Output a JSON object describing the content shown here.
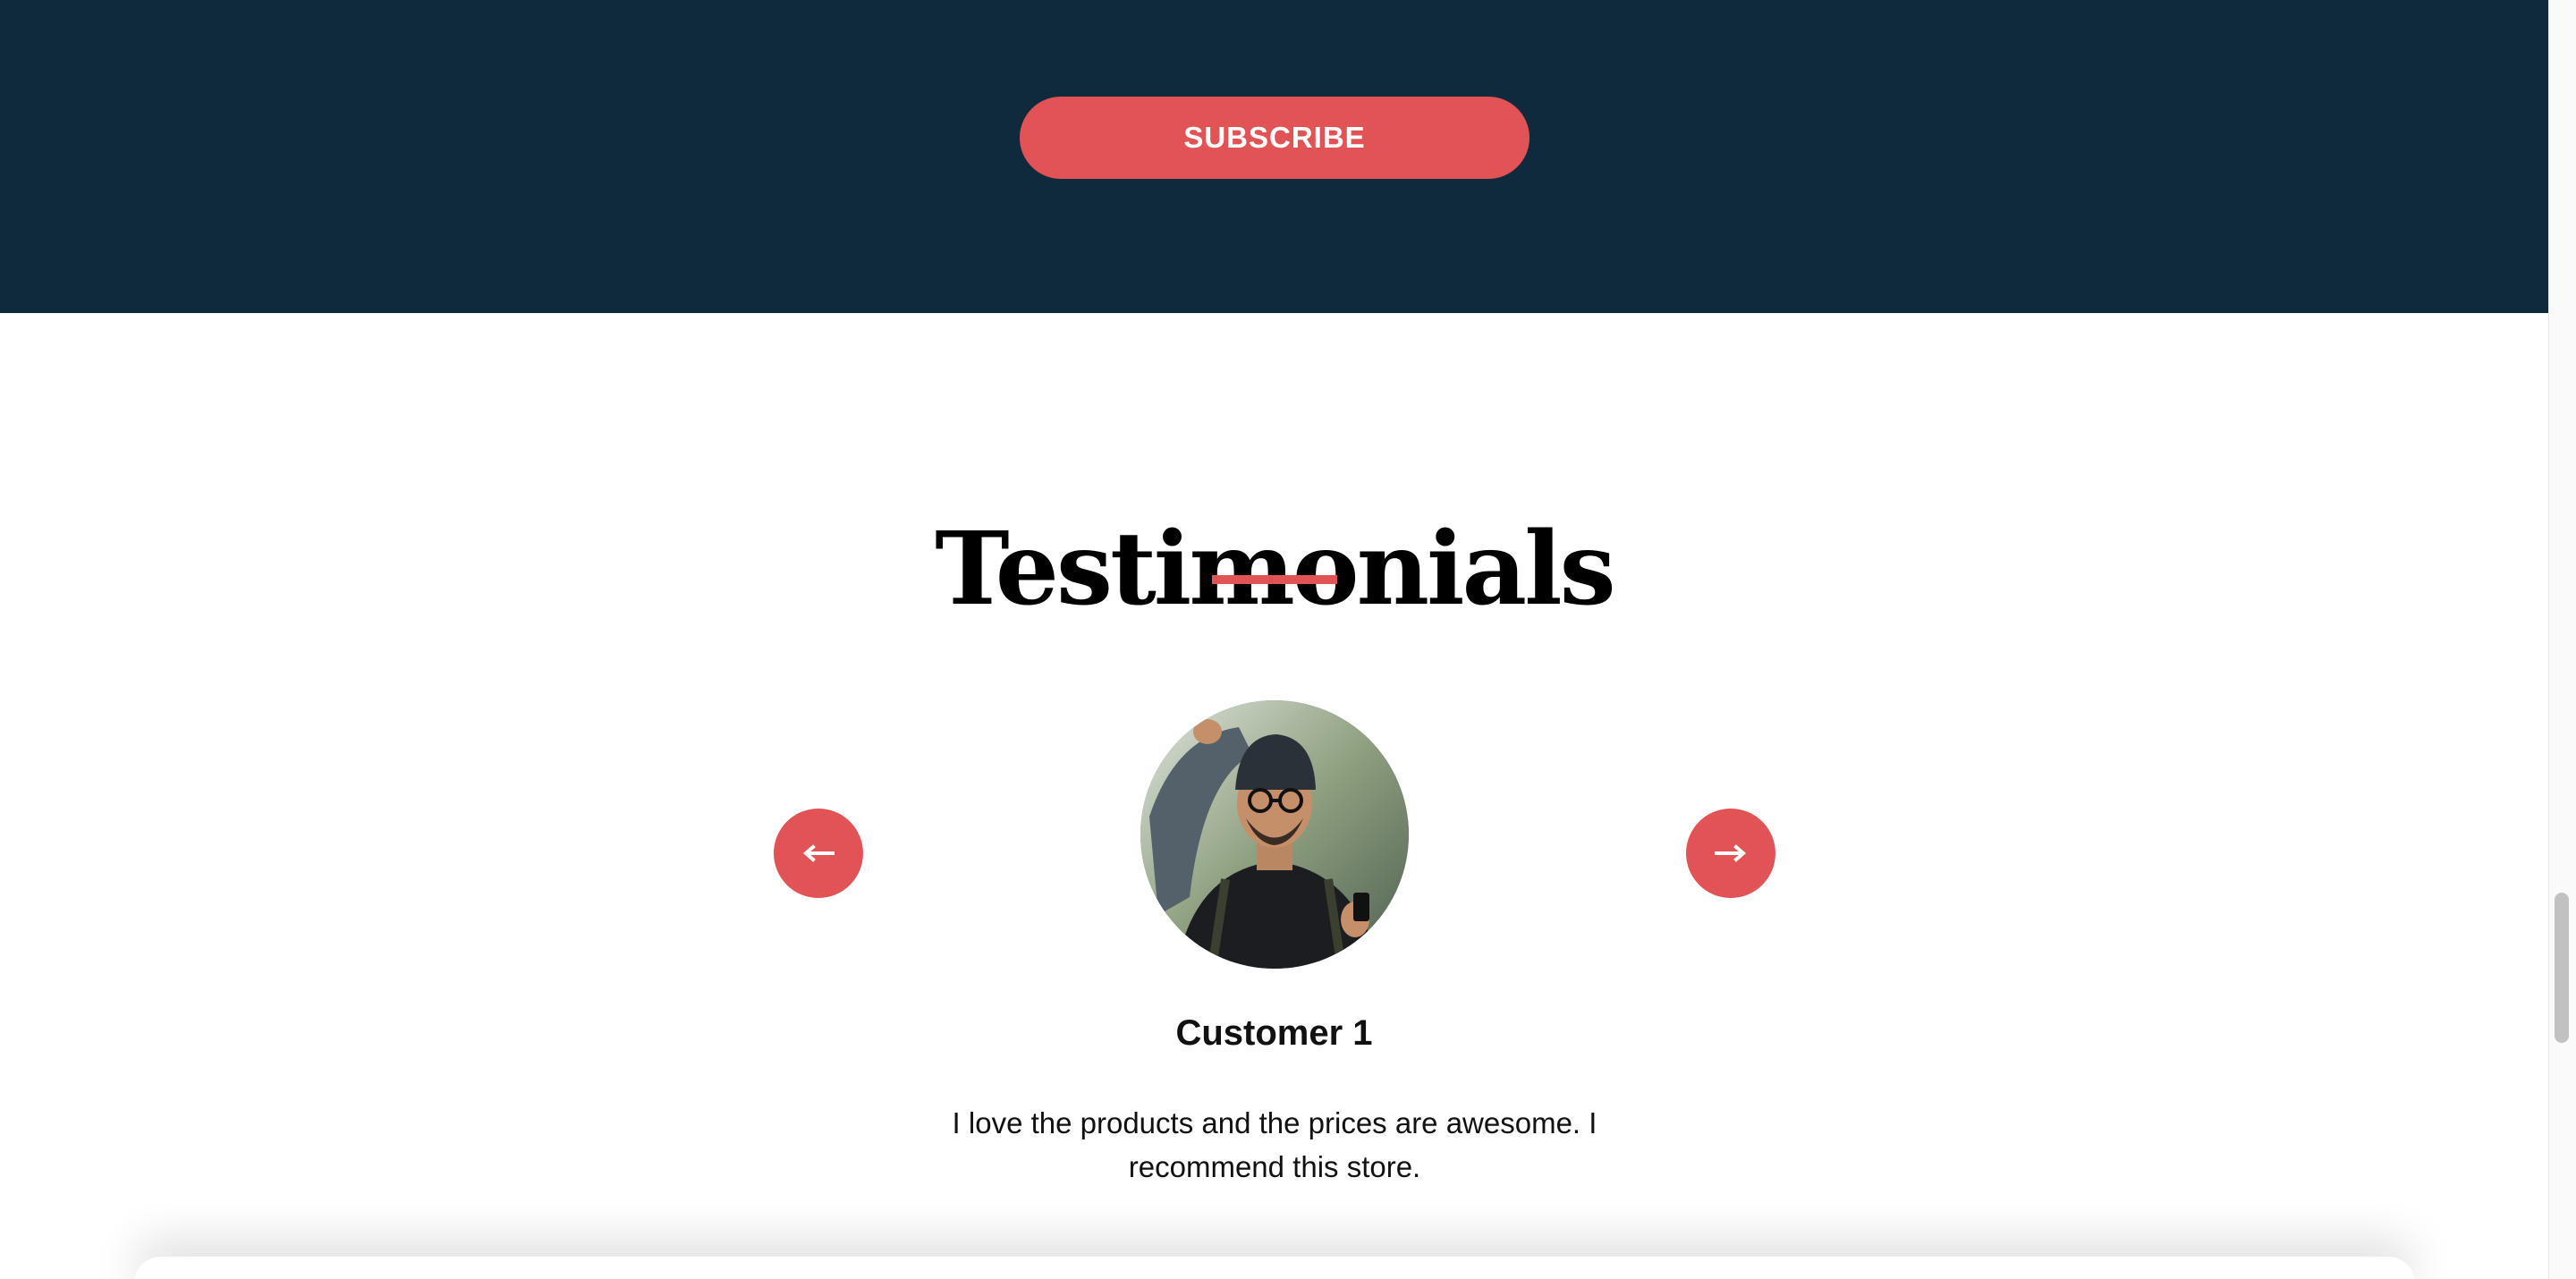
{
  "subscribe": {
    "button_label": "SUBSCRIBE"
  },
  "testimonials": {
    "title": "Testimonials",
    "prev_icon": "arrow-left-icon",
    "next_icon": "arrow-right-icon",
    "current": {
      "name": "Customer 1",
      "quote": "I love the products and the prices are awesome. I recommend this store."
    }
  },
  "colors": {
    "band_background": "#0f2a3d",
    "accent": "#e25355",
    "text": "#111111"
  }
}
